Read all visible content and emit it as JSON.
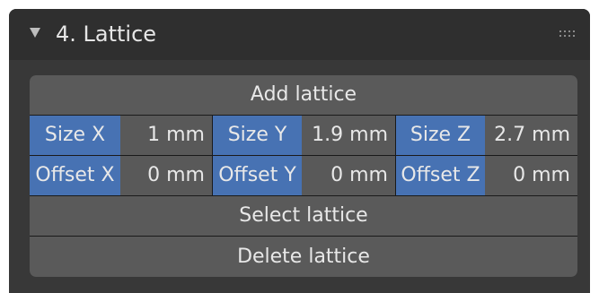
{
  "panel": {
    "title": "4. Lattice"
  },
  "buttons": {
    "add_lattice": "Add lattice",
    "select_lattice": "Select lattice",
    "delete_lattice": "Delete lattice"
  },
  "size_fields": [
    {
      "label": "Size X",
      "value": "1 mm",
      "fill_fraction": 0.5
    },
    {
      "label": "Size Y",
      "value": "1.9 mm",
      "fill_fraction": 0.49
    },
    {
      "label": "Size Z",
      "value": "2.7 mm",
      "fill_fraction": 0.49
    }
  ],
  "offset_fields": [
    {
      "label": "Offset X",
      "value": "0 mm",
      "fill_fraction": 0.5
    },
    {
      "label": "Offset Y",
      "value": "0 mm",
      "fill_fraction": 0.49
    },
    {
      "label": "Offset Z",
      "value": "0 mm",
      "fill_fraction": 0.49
    }
  ],
  "colors": {
    "accent": "#4772b3",
    "panel_bg": "#383838",
    "header_bg": "#2f2f2f",
    "button_bg": "#5a5a5a",
    "text": "#e8e8e8"
  },
  "icons": {
    "collapse": "triangle-down-icon",
    "drag": "grip-dots-icon"
  }
}
